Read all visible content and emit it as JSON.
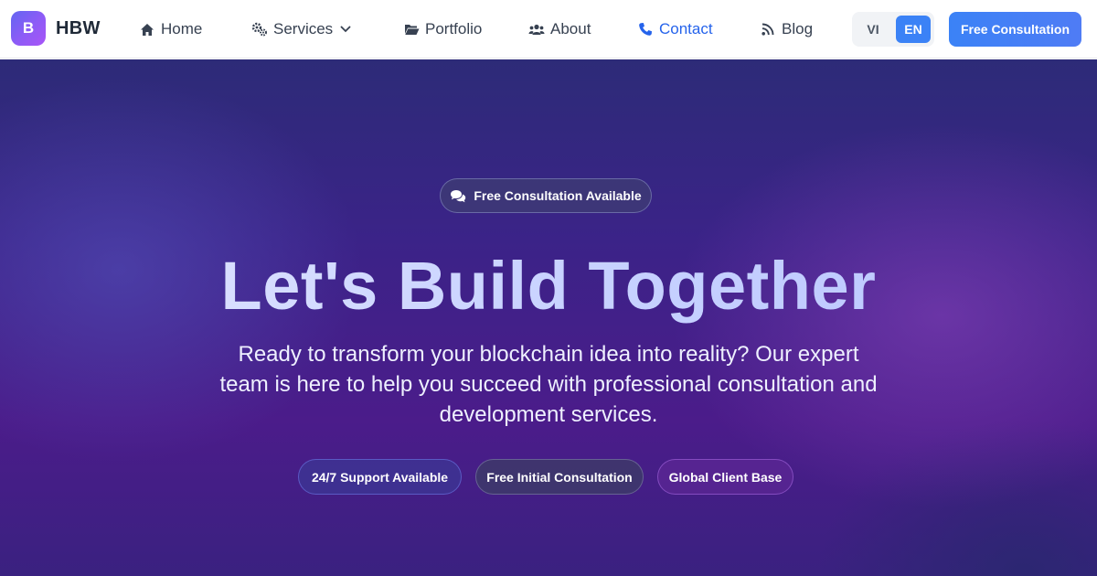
{
  "brand": {
    "logo_letter": "B",
    "name": "HBW"
  },
  "nav": {
    "items": [
      {
        "label": "Home",
        "icon": "home-icon"
      },
      {
        "label": "Services",
        "icon": "gears-icon"
      },
      {
        "label": "Portfolio",
        "icon": "folder-open-icon"
      },
      {
        "label": "About",
        "icon": "users-icon"
      },
      {
        "label": "Contact",
        "icon": "phone-icon",
        "active": true
      },
      {
        "label": "Blog",
        "icon": "rss-icon"
      }
    ],
    "languages": [
      "VI",
      "EN"
    ],
    "selected_language": "EN",
    "cta_label": "Free Consultation"
  },
  "hero": {
    "badge": "Free Consultation Available",
    "title": "Let's Build Together",
    "subtitle": "Ready to transform your blockchain idea into reality? Our expert team is here to help you succeed with professional consultation and development services.",
    "pills": [
      "24/7 Support Available",
      "Free Initial Consultation",
      "Global Client Base"
    ]
  },
  "colors": {
    "accent": "#3b82f6",
    "active_nav": "#2563eb",
    "hero_bg": "#3b2388"
  }
}
